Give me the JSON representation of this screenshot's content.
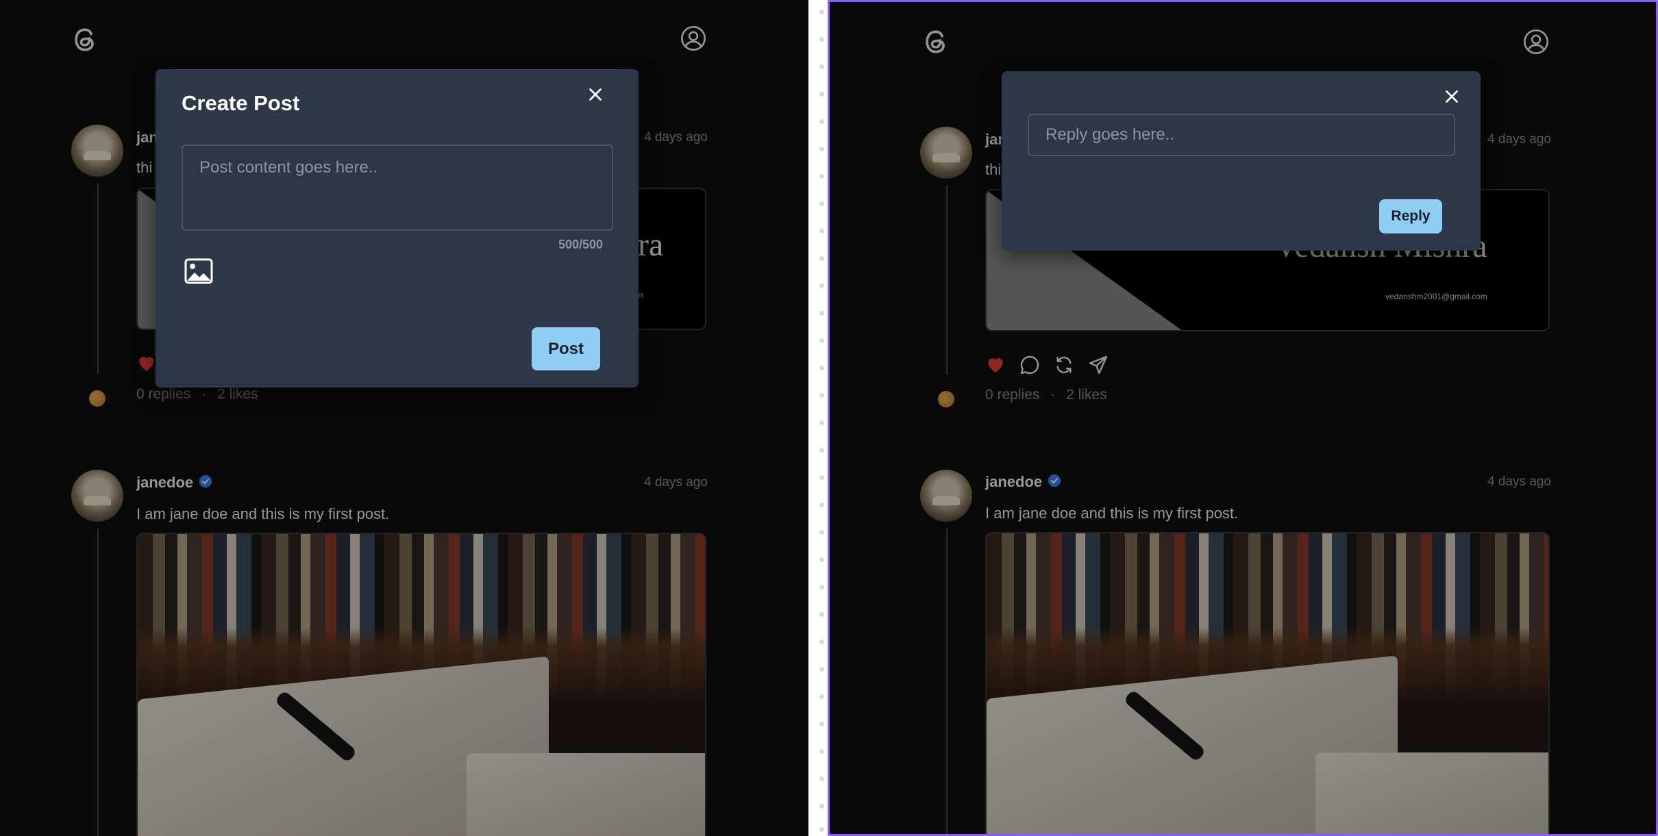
{
  "left_pane": {
    "modal": {
      "title": "Create Post",
      "textarea_placeholder": "Post content goes here..",
      "char_count": "500/500",
      "post_button": "Post"
    },
    "post1": {
      "username": "jan",
      "text": "thi",
      "time": "4 days ago",
      "banner_name": "ra",
      "banner_email": "m",
      "replies": "0 replies",
      "separator": "·",
      "likes": "2 likes"
    },
    "post2": {
      "username": "janedoe",
      "time": "4 days ago",
      "text": "I am jane doe and this is my first post."
    }
  },
  "right_pane": {
    "modal": {
      "input_placeholder": "Reply goes here..",
      "reply_button": "Reply"
    },
    "post1": {
      "username": "jan",
      "text": "thi",
      "time": "4 days ago",
      "banner_name": "Vedansh Mishra",
      "banner_email": "vedanshm2001@gmail.com",
      "replies": "0 replies",
      "separator": "·",
      "likes": "2 likes"
    },
    "post2": {
      "username": "janedoe",
      "time": "4 days ago",
      "text": "I am jane doe and this is my first post."
    }
  },
  "colors": {
    "background": "#101010",
    "modal_bg": "#2d3748",
    "button_bg": "#90cdf4",
    "accent_border": "#8b5cf6",
    "liked_heart": "#e53e3e",
    "verified_badge": "#3b82f6"
  },
  "icons": [
    "threads-logo-icon",
    "profile-icon",
    "close-icon",
    "image-icon",
    "heart-icon",
    "comment-icon",
    "repost-icon",
    "share-icon",
    "verified-icon"
  ]
}
